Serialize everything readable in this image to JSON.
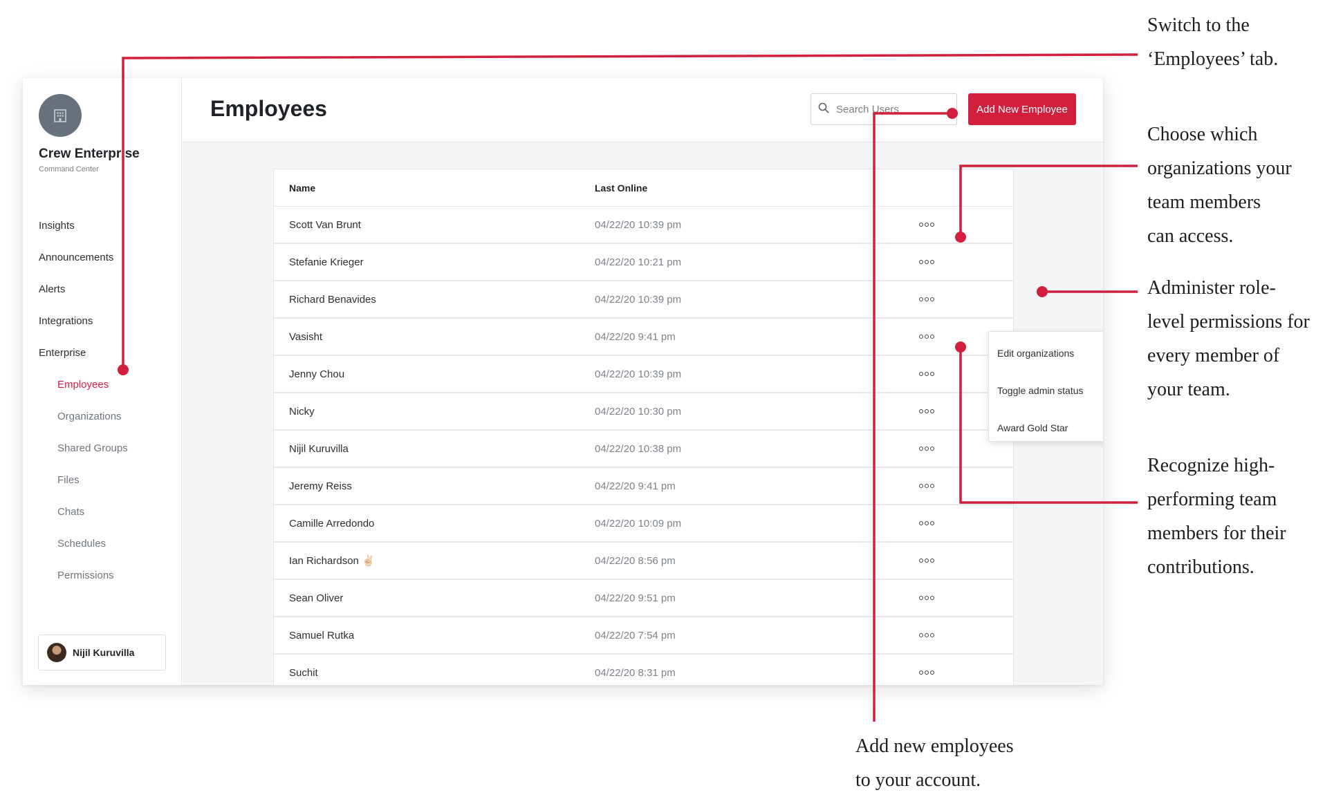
{
  "sidebar": {
    "org_name": "Crew Enterprise",
    "org_subtitle": "Command Center",
    "nav": [
      {
        "label": "Insights"
      },
      {
        "label": "Announcements"
      },
      {
        "label": "Alerts"
      },
      {
        "label": "Integrations"
      },
      {
        "label": "Enterprise"
      },
      {
        "label": "Employees",
        "active": true
      },
      {
        "label": "Organizations"
      },
      {
        "label": "Shared Groups"
      },
      {
        "label": "Files"
      },
      {
        "label": "Chats"
      },
      {
        "label": "Schedules"
      },
      {
        "label": "Permissions"
      }
    ],
    "user": {
      "name": "Nijil Kuruvilla"
    }
  },
  "header": {
    "title": "Employees",
    "search_placeholder": "Search Users",
    "add_button": "Add New Employee"
  },
  "table": {
    "columns": [
      "Name",
      "Last Online"
    ],
    "rows": [
      {
        "name": "Scott Van Brunt",
        "last_online": "04/22/20 10:39 pm"
      },
      {
        "name": "Stefanie Krieger",
        "last_online": "04/22/20 10:21 pm"
      },
      {
        "name": "Richard Benavides",
        "last_online": "04/22/20 10:39 pm"
      },
      {
        "name": "Vasisht",
        "last_online": "04/22/20 9:41 pm"
      },
      {
        "name": "Jenny Chou",
        "last_online": "04/22/20 10:39 pm"
      },
      {
        "name": "Nicky",
        "last_online": "04/22/20 10:30 pm"
      },
      {
        "name": "Nijil Kuruvilla",
        "last_online": "04/22/20 10:38 pm"
      },
      {
        "name": "Jeremy Reiss",
        "last_online": "04/22/20 9:41 pm"
      },
      {
        "name": "Camille Arredondo",
        "last_online": "04/22/20 10:09 pm"
      },
      {
        "name": "Ian Richardson ✌🏻",
        "last_online": "04/22/20 8:56 pm"
      },
      {
        "name": "Sean Oliver",
        "last_online": "04/22/20 9:51 pm"
      },
      {
        "name": "Samuel Rutka",
        "last_online": "04/22/20 7:54 pm"
      },
      {
        "name": "Suchit",
        "last_online": "04/22/20 8:31 pm"
      }
    ]
  },
  "row_menu": {
    "items": [
      {
        "label": "Edit organizations"
      },
      {
        "label": "Toggle admin status"
      },
      {
        "label": "Award Gold Star"
      }
    ]
  },
  "annotations": {
    "employees_tab": "Switch to the\n‘Employees’ tab.",
    "organizations": "Choose which\norganizations your\nteam members\ncan access.",
    "admin": "Administer role-\nlevel permissions for\nevery member of\nyour team.",
    "gold_star": "Recognize high-\nperforming team\nmembers for their\ncontributions.",
    "add_employees": "Add new employees\nto your account."
  },
  "colors": {
    "accent": "#d11f3d",
    "logo_bg": "#67727d",
    "background": "#f4f5f7"
  },
  "icons": {
    "logo": "building-icon",
    "search": "search-icon",
    "row_actions": "more-horizontal-icon"
  }
}
